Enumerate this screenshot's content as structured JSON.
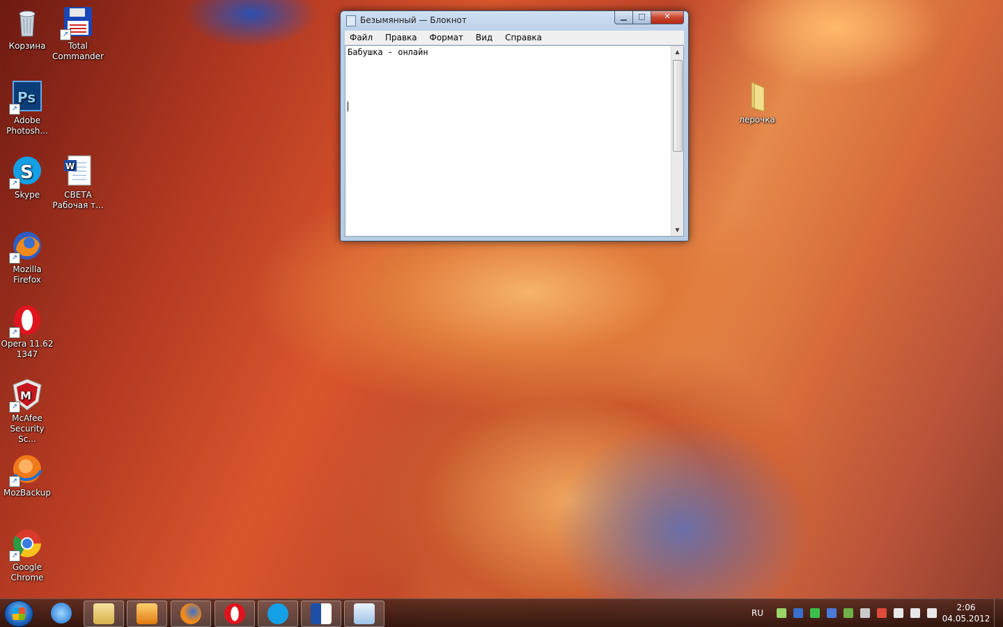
{
  "desktop": {
    "icons": [
      {
        "label": "Корзина",
        "icon": "recycle-bin-icon"
      },
      {
        "label": "Total Commander",
        "icon": "total-commander-icon"
      },
      {
        "label": "Adobe Photosh...",
        "icon": "photoshop-icon"
      },
      {
        "label": "Skype",
        "icon": "skype-icon"
      },
      {
        "label": "СВЕТА Рабочая т...",
        "icon": "word-document-icon"
      },
      {
        "label": "Mozilla Firefox",
        "icon": "firefox-icon"
      },
      {
        "label": "Opera 11.62 1347",
        "icon": "opera-icon"
      },
      {
        "label": "McAfee Security Sc...",
        "icon": "mcafee-icon"
      },
      {
        "label": "MozBackup",
        "icon": "mozbackup-icon"
      },
      {
        "label": "Google Chrome",
        "icon": "chrome-icon"
      },
      {
        "label": "лерочка",
        "icon": "folder-icon"
      }
    ]
  },
  "notepad": {
    "title": "Безымянный — Блокнот",
    "menu": [
      "Файл",
      "Правка",
      "Формат",
      "Вид",
      "Справка"
    ],
    "content": "Бабушка - онлайн",
    "buttons": {
      "minimize": "▁",
      "maximize": "□",
      "close": "✕"
    }
  },
  "taskbar": {
    "language": "RU",
    "time": "2:06",
    "date": "04.05.2012",
    "pinned": [
      "internet-explorer-icon",
      "explorer-icon",
      "media-player-icon",
      "firefox-icon",
      "opera-icon",
      "skype-icon",
      "word-icon",
      "notepad-icon"
    ]
  }
}
